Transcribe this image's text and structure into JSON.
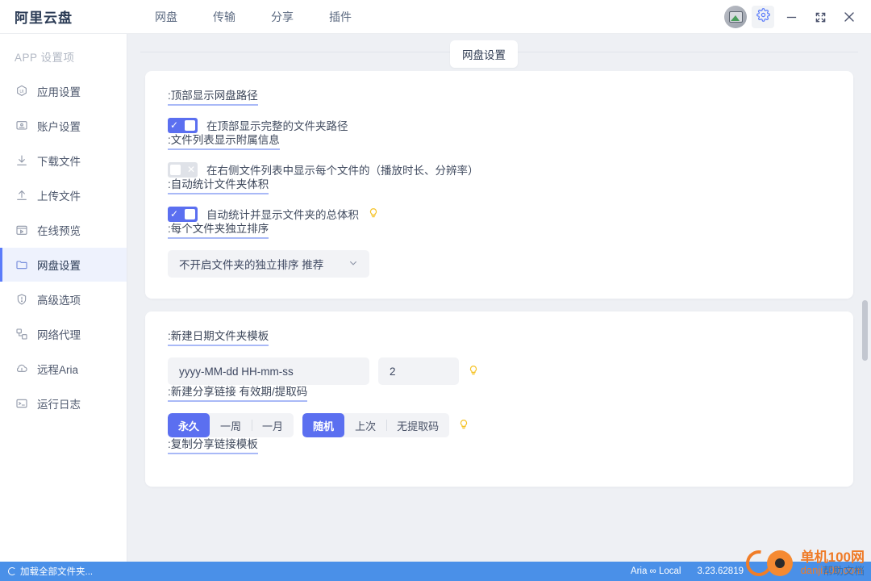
{
  "titlebar": {
    "brand": "阿里云盘",
    "nav": [
      {
        "label": "网盘"
      },
      {
        "label": "传输"
      },
      {
        "label": "分享"
      },
      {
        "label": "插件"
      }
    ],
    "avatar_icon": "user-avatar",
    "gear_icon": "gear-icon",
    "minimize_icon": "minimize-icon",
    "maximize_icon": "maximize-icon",
    "close_icon": "close-icon"
  },
  "sidebar": {
    "title": "APP 设置项",
    "items": [
      {
        "label": "应用设置",
        "icon": "ui-hexagon-icon",
        "active": false
      },
      {
        "label": "账户设置",
        "icon": "account-card-icon",
        "active": false
      },
      {
        "label": "下载文件",
        "icon": "download-icon",
        "active": false
      },
      {
        "label": "上传文件",
        "icon": "upload-icon",
        "active": false
      },
      {
        "label": "在线预览",
        "icon": "preview-play-icon",
        "active": false
      },
      {
        "label": "网盘设置",
        "icon": "folder-icon",
        "active": true
      },
      {
        "label": "高级选项",
        "icon": "shield-alert-icon",
        "active": false
      },
      {
        "label": "网络代理",
        "icon": "network-proxy-icon",
        "active": false
      },
      {
        "label": "远程Aria",
        "icon": "cloud-icon",
        "active": false
      },
      {
        "label": "运行日志",
        "icon": "terminal-icon",
        "active": false
      }
    ]
  },
  "main": {
    "tab_chip": "网盘设置",
    "card1": {
      "group1_label": ":顶部显示网盘路径",
      "group1_caption": "在顶部显示完整的文件夹路径",
      "group1_toggle": "on",
      "group2_label": ":文件列表显示附属信息",
      "group2_caption": "在右侧文件列表中显示每个文件的（播放时长、分辨率）",
      "group2_toggle": "off",
      "group3_label": ":自动统计文件夹体积",
      "group3_caption": "自动统计并显示文件夹的总体积",
      "group3_toggle": "on",
      "group3_hint_icon": "lightbulb-icon",
      "group4_label": ":每个文件夹独立排序",
      "group4_select_value": "不开启文件夹的独立排序 推荐",
      "group4_chevron": "chevron-down-icon"
    },
    "card2": {
      "date_label": ":新建日期文件夹模板",
      "date_template_value": "yyyy-MM-dd HH-mm-ss",
      "date_template_placeholder": "yyyy-MM-dd HH-mm-ss",
      "date_count_value": "2",
      "date_hint_icon": "lightbulb-icon",
      "share_label": ":新建分享链接 有效期/提取码",
      "expiry_options": [
        {
          "label": "永久",
          "selected": true
        },
        {
          "label": "一周",
          "selected": false
        },
        {
          "label": "一月",
          "selected": false
        }
      ],
      "code_options": [
        {
          "label": "随机",
          "selected": true
        },
        {
          "label": "上次",
          "selected": false
        },
        {
          "label": "无提取码",
          "selected": false
        }
      ],
      "share_hint_icon": "lightbulb-icon",
      "copy_label": ":复制分享链接模板"
    }
  },
  "statusbar": {
    "loading_icon": "spinner-icon",
    "loading_text": "加载全部文件夹...",
    "aria_status": "Aria ∞ Local",
    "version": "3.23.62819"
  },
  "watermark": {
    "title": "单机100网",
    "subtitle": "danji100.com",
    "overlay": "帮助文档",
    "logo_icon": "orange-co-logo"
  },
  "colors": {
    "accent": "#5b6ff0",
    "sidebar_active_bg": "#eef2fd",
    "status_bar": "#4a90e8",
    "bulb": "#f5c224",
    "watermark": "#ef7b27"
  }
}
